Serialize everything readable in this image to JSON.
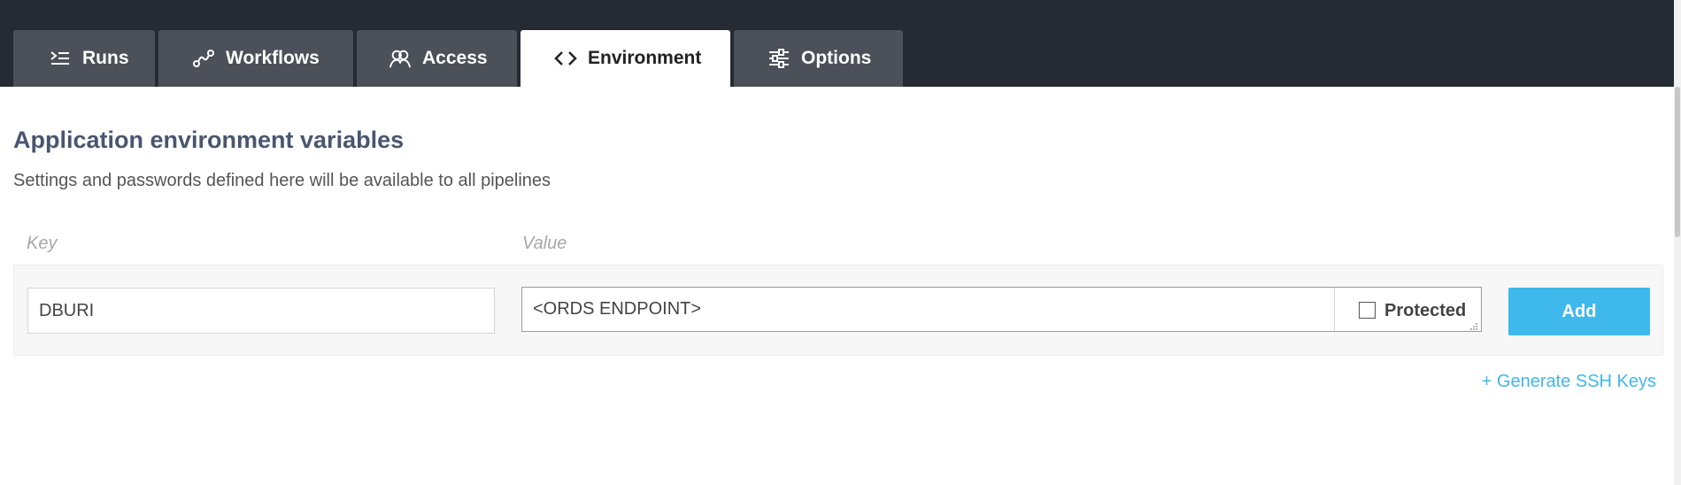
{
  "tabs": [
    {
      "label": "Runs",
      "icon": "runs-list-icon",
      "active": false
    },
    {
      "label": "Workflows",
      "icon": "workflows-link-icon",
      "active": false
    },
    {
      "label": "Access",
      "icon": "access-users-icon",
      "active": false
    },
    {
      "label": "Environment",
      "icon": "code-brackets-icon",
      "active": true
    },
    {
      "label": "Options",
      "icon": "options-sliders-icon",
      "active": false
    }
  ],
  "page": {
    "title": "Application environment variables",
    "subtitle": "Settings and passwords defined here will be available to all pipelines"
  },
  "form": {
    "key_label": "Key",
    "value_label": "Value",
    "key_value": "DBURI",
    "value_value": "<ORDS ENDPOINT>",
    "protected_label": "Protected",
    "protected_checked": false,
    "add_label": "Add"
  },
  "links": {
    "generate_ssh": "+ Generate SSH Keys"
  },
  "colors": {
    "topbar": "#252a33",
    "tab_inactive": "#4b5059",
    "accent": "#3fb8ec",
    "title": "#4a5670"
  }
}
